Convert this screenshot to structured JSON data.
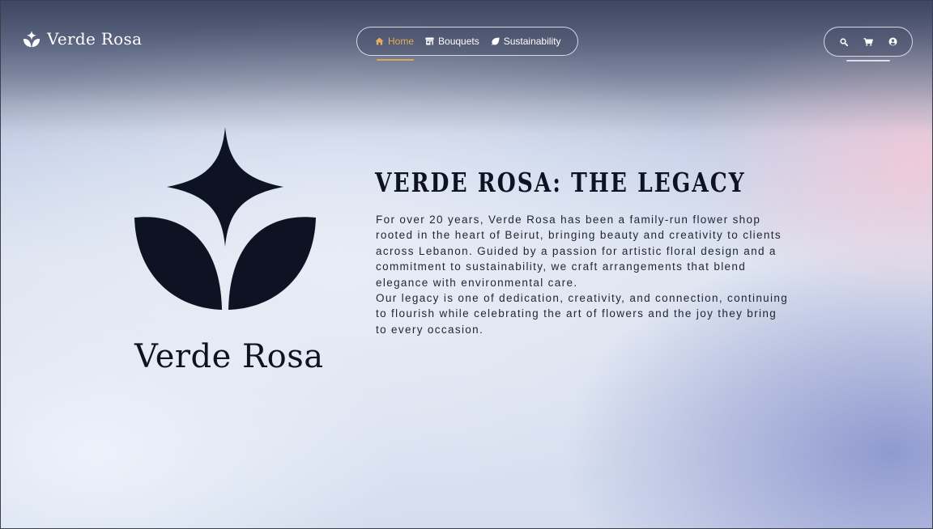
{
  "brand": {
    "name": "Verde Rosa",
    "icon": "lotus-star-logo-icon"
  },
  "nav": {
    "items": [
      {
        "label": "Home",
        "icon": "home-icon",
        "active": true
      },
      {
        "label": "Bouquets",
        "icon": "store-icon",
        "active": false
      },
      {
        "label": "Sustainability",
        "icon": "leaf-icon",
        "active": false
      }
    ]
  },
  "actions": {
    "icons": [
      "search-icon",
      "cart-icon",
      "user-icon"
    ]
  },
  "hero": {
    "logo_icon": "lotus-star-logo-icon",
    "wordmark": "Verde Rosa"
  },
  "content": {
    "title": "VERDE ROSA: THE LEGACY",
    "paragraph1": "For over 20 years, Verde Rosa has been a family-run flower shop rooted in the heart of Beirut, bringing beauty and creativity to clients across Lebanon. Guided by a passion for artistic floral design and a commitment to sustainability, we craft arrangements that blend elegance with environmental care.",
    "paragraph2": "Our legacy is one of dedication, creativity, and connection, continuing to flourish while celebrating the art of flowers and the joy they bring to every occasion."
  },
  "colors": {
    "accent": "#e7ad5a",
    "ink": "#0e1324",
    "text": "#1f2433"
  }
}
